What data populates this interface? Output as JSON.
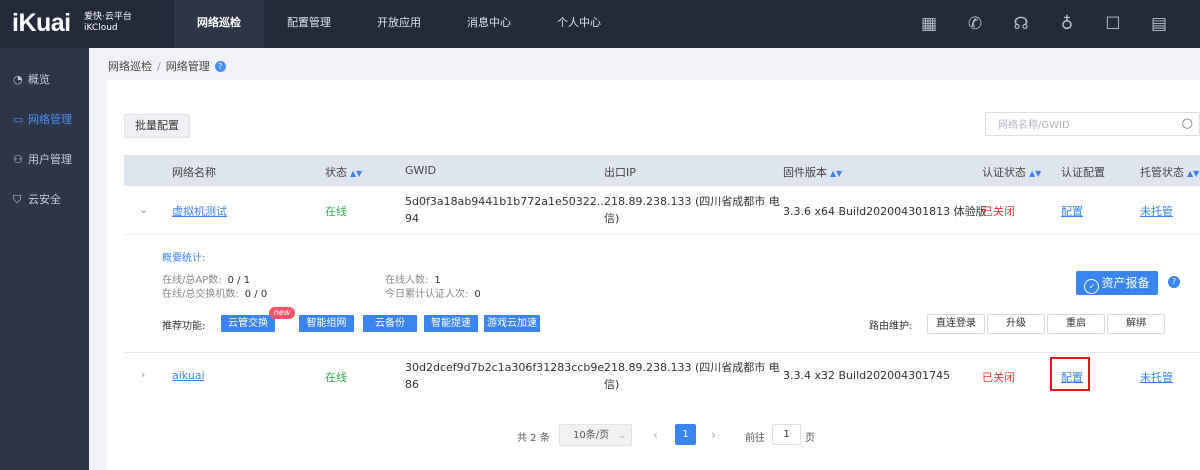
{
  "brand": {
    "logo": "iKuai",
    "name": "爱快·云平台",
    "sub": "iKCloud"
  },
  "topnav": [
    {
      "label": "网络巡检",
      "active": true
    },
    {
      "label": "配置管理"
    },
    {
      "label": "开放应用"
    },
    {
      "label": "消息中心"
    },
    {
      "label": "个人中心"
    }
  ],
  "topicons": [
    {
      "name": "apps-icon",
      "glyph": "▦"
    },
    {
      "name": "tools-icon",
      "glyph": "✆"
    },
    {
      "name": "headset-icon",
      "glyph": "☊"
    },
    {
      "name": "lightbulb-icon",
      "glyph": "♁"
    },
    {
      "name": "message-icon",
      "glyph": "☐"
    },
    {
      "name": "document-icon",
      "glyph": "▤"
    }
  ],
  "sidebar": [
    {
      "label": "概览",
      "icon": "◔",
      "icon_name": "overview-icon"
    },
    {
      "label": "网络管理",
      "icon": "▭",
      "icon_name": "network-icon",
      "active": true
    },
    {
      "label": "用户管理",
      "icon": "⚇",
      "icon_name": "user-icon"
    },
    {
      "label": "云安全",
      "icon": "⛉",
      "icon_name": "shield-icon"
    }
  ],
  "breadcrumb": {
    "parent": "网络巡检",
    "separator": "/",
    "current": "网络管理",
    "help": "?"
  },
  "toolbar": {
    "batch_label": "批量配置",
    "search_placeholder": "网络名称/GWID"
  },
  "table": {
    "headers": {
      "name": "网络名称",
      "status": "状态",
      "gwid": "GWID",
      "ip": "出口IP",
      "firmware": "固件版本",
      "auth_status": "认证状态",
      "auth_config": "认证配置",
      "hosting": "托管状态"
    },
    "rows": [
      {
        "name": "虚拟机测试",
        "status": "在线",
        "gwid_line1": "5d0f3a18ab9441b1b772a1e50322...",
        "gwid_line2": "94",
        "ip_line1": "218.89.238.133 (四川省成都市 电",
        "ip_line2": "信)",
        "firmware": "3.3.6 x64 Build202004301813 体验版",
        "auth_status": "已关闭",
        "auth_config": "配置",
        "hosting": "未托管"
      },
      {
        "name": "aikuai",
        "status": "在线",
        "gwid_line1": "30d2dcef9d7b2c1a306f31283ccb9e",
        "gwid_line2": "86",
        "ip_line1": "218.89.238.133 (四川省成都市 电",
        "ip_line2": "信)",
        "firmware": "3.3.4 x32 Build202004301745",
        "auth_status": "已关闭",
        "auth_config": "配置",
        "hosting": "未托管"
      }
    ]
  },
  "detail": {
    "summary_title": "概要统计:",
    "ap_label": "在线/总AP数:",
    "ap_value": "0 / 1",
    "switch_label": "在线/总交换机数:",
    "switch_value": "0 / 0",
    "online_label": "在线人数:",
    "online_value": "1",
    "auth_label": "今日累计认证人次:",
    "auth_value": "0",
    "asset_btn": "资产报备",
    "asset_help": "?",
    "rec_label": "推荐功能:",
    "rec_buttons": [
      "云管交换",
      "智能组网",
      "云备份",
      "智能提速",
      "游戏云加速"
    ],
    "new_badge": "new",
    "maint_label": "路由维护:",
    "maint_buttons": [
      "直连登录",
      "升级",
      "重启",
      "解绑"
    ]
  },
  "pager": {
    "total": "共 2 条",
    "page_size": "10条/页",
    "current": "1",
    "goto_label": "前往",
    "goto_value": "1",
    "page_suffix": "页"
  },
  "colors": {
    "accent": "#3a84f0",
    "topbar": "#232b3a",
    "sidebar": "#2d3648",
    "online": "#2fb14a",
    "closed": "#e53935",
    "highlight": "#e0191f"
  }
}
